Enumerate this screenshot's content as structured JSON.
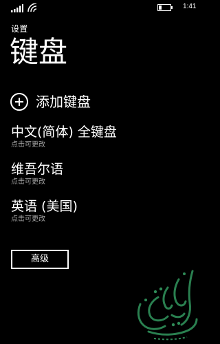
{
  "status_bar": {
    "time": "1:41",
    "icons": [
      "signal-icon",
      "wifi-icon",
      "battery-icon"
    ]
  },
  "header": {
    "app_title": "设置",
    "page_title": "键盘"
  },
  "actions": {
    "add_keyboard_label": "添加键盘",
    "add_icon": "plus-circle-icon"
  },
  "keyboards": [
    {
      "name": "中文(简体) 全键盘",
      "subtitle": "点击可更改"
    },
    {
      "name": "维吾尔语",
      "subtitle": "点击可更改"
    },
    {
      "name": "英语 (美国)",
      "subtitle": "点击可更改"
    }
  ],
  "advanced_button": {
    "label": "高级"
  },
  "watermark": {
    "description_icon": "arabic-calligraphy-watermark",
    "color": "#2e8b57"
  },
  "colors": {
    "background": "#000000",
    "foreground": "#ffffff",
    "secondary_text": "#a6a6a6"
  }
}
